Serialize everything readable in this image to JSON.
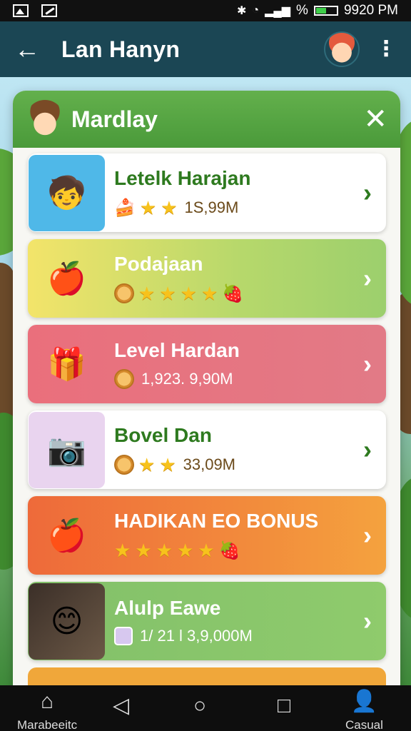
{
  "status_bar": {
    "battery_text": "%",
    "time": "9920 PM"
  },
  "app_bar": {
    "title": "Lan Hanyn"
  },
  "panel": {
    "title": "Mardlay"
  },
  "items": [
    {
      "title": "Letelk Harajan",
      "value": "1S,99M"
    },
    {
      "title": "Podajaan",
      "value": ""
    },
    {
      "title": "Level Hardan",
      "value": "1,923. 9,90M"
    },
    {
      "title": "Bovel Dan",
      "value": "33,09M"
    },
    {
      "title": "HADIKAN EO BONUS",
      "value": ""
    },
    {
      "title": "Alulp Eawe",
      "value": "1/ 21 l 3,9,000M"
    }
  ],
  "bottom_nav": {
    "left_label": "Marabeeitc",
    "right_label": "Casual"
  },
  "colors": {
    "app_bar": "#1b4654",
    "panel_header": "#4a9a3a",
    "accent_green": "#2e7a1f"
  }
}
